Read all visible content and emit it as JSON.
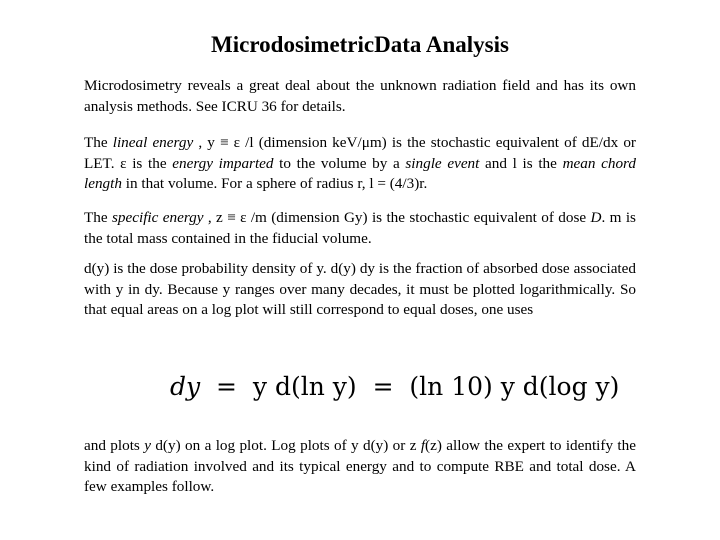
{
  "title": "MicrodosimetricData Analysis",
  "paragraphs": {
    "p1": "Microdosimetry reveals a great deal about the unknown radiation field and has its own analysis methods. See ICRU 36 for details.",
    "p2": {
      "t1": "The ",
      "i1": "lineal energy",
      "t2": " , y ≡ ε /l (dimension keV/μm) is the stochastic equivalent of dE/dx or LET. ε is the ",
      "i2": "energy imparted",
      "t3": " to the volume by a ",
      "i3": "single event",
      "t4": " and l is the ",
      "i4": "mean chord length",
      "t5": " in that volume. For a sphere of radius r, l = (4/3)r."
    },
    "p3": {
      "t1": "The ",
      "i1": "specific energy",
      "t2": " , z ≡ ε /m (dimension Gy) is the stochastic equivalent of dose ",
      "i2": "D",
      "t3": ". m is the total mass contained in the fiducial volume."
    },
    "p4": "d(y) is the dose probability density of y. d(y) dy is the fraction of absorbed dose associated with y in dy. Because y ranges over many decades, it must be plotted logarithmically. So that equal areas on a log plot will still correspond to equal doses, one uses",
    "equation": {
      "lhs": "dy",
      "eq": "=",
      "mid": "y d(ln y)",
      "rhs": "(ln 10) y d(log y)"
    },
    "p5": {
      "t1": "and plots ",
      "i1": "y",
      "t2": " d(y) on a log plot. Log plots of y d(y) or z ",
      "i2": "f",
      "t3": "(z) allow the expert to identify the kind of radiation involved and its typical energy  and to compute RBE and total dose. A few examples follow."
    }
  }
}
